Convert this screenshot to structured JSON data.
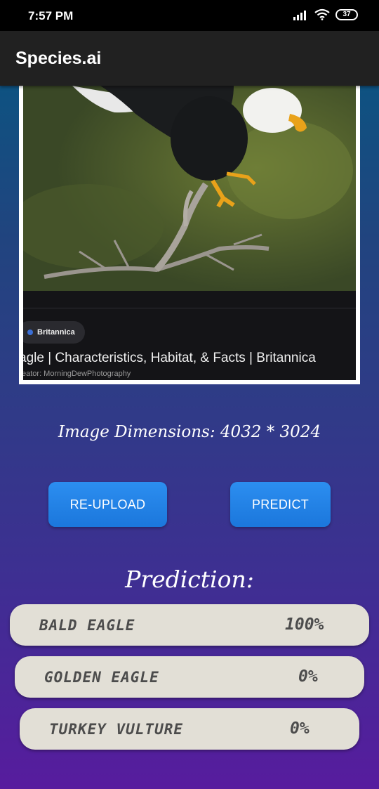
{
  "status_bar": {
    "time": "7:57 PM",
    "battery": "37",
    "icons": [
      "signal-icon",
      "wifi-icon",
      "battery-icon"
    ]
  },
  "app_bar": {
    "title": "Species.ai"
  },
  "image": {
    "source_badge": "Britannica",
    "headline": "agle | Characteristics, Habitat, & Facts | Britannica",
    "credit": "eator: MorningDewPhotography"
  },
  "dimensions_text": "Image Dimensions: 4032 * 3024",
  "buttons": {
    "reupload": "RE-UPLOAD",
    "predict": "PREDICT"
  },
  "prediction_heading": "Prediction:",
  "predictions": [
    {
      "label": "Bald Eagle",
      "value": "100%"
    },
    {
      "label": "Golden Eagle",
      "value": "0%"
    },
    {
      "label": "Turkey Vulture",
      "value": "0%"
    }
  ],
  "colors": {
    "accent_button": "#1e88e5",
    "app_bar": "#212121",
    "gradient_top": "#0e5281",
    "gradient_bottom": "#571c9e",
    "prediction_card": "#e2dfd6"
  }
}
